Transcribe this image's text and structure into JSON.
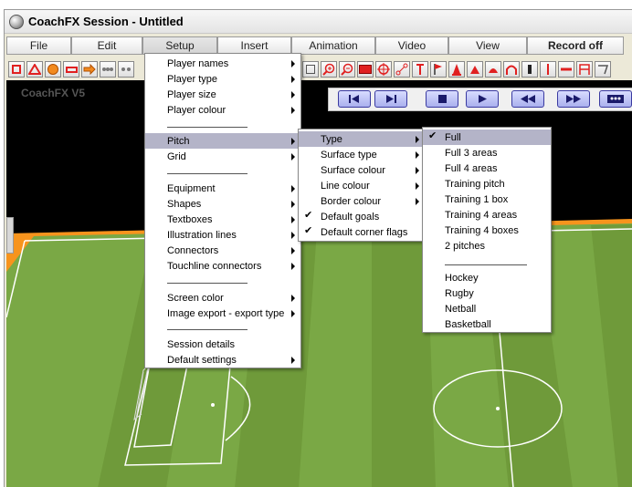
{
  "window": {
    "title": "CoachFX Session - Untitled"
  },
  "menubar": [
    {
      "label": "File"
    },
    {
      "label": "Edit"
    },
    {
      "label": "Setup"
    },
    {
      "label": "Insert"
    },
    {
      "label": "Animation"
    },
    {
      "label": "Video"
    },
    {
      "label": "View"
    },
    {
      "label": "Record off"
    }
  ],
  "canvas": {
    "version_label": "CoachFX V5"
  },
  "setup_menu": {
    "items": [
      {
        "label": "Player names"
      },
      {
        "label": "Player type"
      },
      {
        "label": "Player size"
      },
      {
        "label": "Player colour"
      },
      {
        "label": "Pitch"
      },
      {
        "label": "Grid"
      },
      {
        "label": "Equipment"
      },
      {
        "label": "Shapes"
      },
      {
        "label": "Textboxes"
      },
      {
        "label": "Illustration lines"
      },
      {
        "label": "Connectors"
      },
      {
        "label": "Touchline connectors"
      },
      {
        "label": "Screen color"
      },
      {
        "label": "Image export - export type"
      },
      {
        "label": "Session details"
      },
      {
        "label": "Default settings"
      }
    ]
  },
  "pitch_menu": {
    "items": [
      {
        "label": "Type"
      },
      {
        "label": "Surface type"
      },
      {
        "label": "Surface colour"
      },
      {
        "label": "Line colour"
      },
      {
        "label": "Border colour"
      },
      {
        "label": "Default goals",
        "checked": true
      },
      {
        "label": "Default corner flags",
        "checked": true
      }
    ]
  },
  "type_menu": {
    "items": [
      {
        "label": "Full",
        "checked": true
      },
      {
        "label": "Full 3 areas"
      },
      {
        "label": "Full 4 areas"
      },
      {
        "label": "Training pitch"
      },
      {
        "label": "Training 1 box"
      },
      {
        "label": "Training 4 areas"
      },
      {
        "label": "Training 4 boxes"
      },
      {
        "label": "2 pitches"
      },
      {
        "label": "Hockey"
      },
      {
        "label": "Rugby"
      },
      {
        "label": "Netball"
      },
      {
        "label": "Basketball"
      }
    ]
  },
  "colors": {
    "pitch_stripe_light": "#82b04a",
    "pitch_stripe_dark": "#6f9a3a",
    "pitch_border": "#f7941d",
    "menu_highlight": "#b4b4c8",
    "play_button": "#aab0ee",
    "tool_red": "#e02020",
    "tool_orange": "#f28a1e"
  }
}
